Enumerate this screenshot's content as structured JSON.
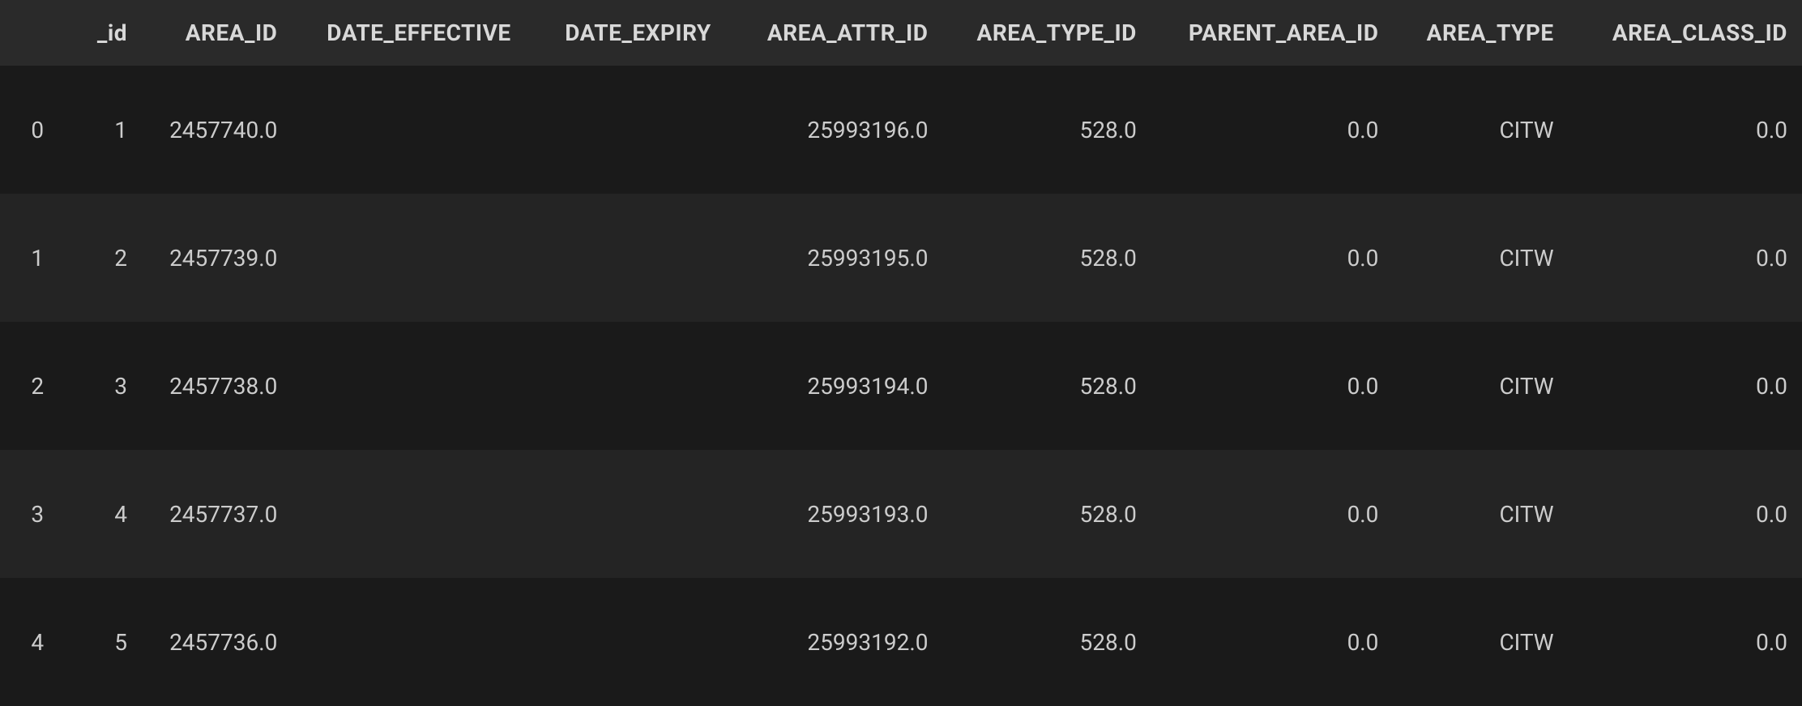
{
  "table": {
    "columns": [
      {
        "key": "_index",
        "label": ""
      },
      {
        "key": "_id",
        "label": "_id"
      },
      {
        "key": "AREA_ID",
        "label": "AREA_ID"
      },
      {
        "key": "DATE_EFFECTIVE",
        "label": "DATE_EFFECTIVE"
      },
      {
        "key": "DATE_EXPIRY",
        "label": "DATE_EXPIRY"
      },
      {
        "key": "AREA_ATTR_ID",
        "label": "AREA_ATTR_ID"
      },
      {
        "key": "AREA_TYPE_ID",
        "label": "AREA_TYPE_ID"
      },
      {
        "key": "PARENT_AREA_ID",
        "label": "PARENT_AREA_ID"
      },
      {
        "key": "AREA_TYPE",
        "label": "AREA_TYPE"
      },
      {
        "key": "AREA_CLASS_ID",
        "label": "AREA_CLASS_ID"
      }
    ],
    "rows": [
      {
        "_index": "0",
        "_id": "1",
        "AREA_ID": "2457740.0",
        "DATE_EFFECTIVE": "",
        "DATE_EXPIRY": "",
        "AREA_ATTR_ID": "25993196.0",
        "AREA_TYPE_ID": "528.0",
        "PARENT_AREA_ID": "0.0",
        "AREA_TYPE": "CITW",
        "AREA_CLASS_ID": "0.0"
      },
      {
        "_index": "1",
        "_id": "2",
        "AREA_ID": "2457739.0",
        "DATE_EFFECTIVE": "",
        "DATE_EXPIRY": "",
        "AREA_ATTR_ID": "25993195.0",
        "AREA_TYPE_ID": "528.0",
        "PARENT_AREA_ID": "0.0",
        "AREA_TYPE": "CITW",
        "AREA_CLASS_ID": "0.0"
      },
      {
        "_index": "2",
        "_id": "3",
        "AREA_ID": "2457738.0",
        "DATE_EFFECTIVE": "",
        "DATE_EXPIRY": "",
        "AREA_ATTR_ID": "25993194.0",
        "AREA_TYPE_ID": "528.0",
        "PARENT_AREA_ID": "0.0",
        "AREA_TYPE": "CITW",
        "AREA_CLASS_ID": "0.0"
      },
      {
        "_index": "3",
        "_id": "4",
        "AREA_ID": "2457737.0",
        "DATE_EFFECTIVE": "",
        "DATE_EXPIRY": "",
        "AREA_ATTR_ID": "25993193.0",
        "AREA_TYPE_ID": "528.0",
        "PARENT_AREA_ID": "0.0",
        "AREA_TYPE": "CITW",
        "AREA_CLASS_ID": "0.0"
      },
      {
        "_index": "4",
        "_id": "5",
        "AREA_ID": "2457736.0",
        "DATE_EFFECTIVE": "",
        "DATE_EXPIRY": "",
        "AREA_ATTR_ID": "25993192.0",
        "AREA_TYPE_ID": "528.0",
        "PARENT_AREA_ID": "0.0",
        "AREA_TYPE": "CITW",
        "AREA_CLASS_ID": "0.0"
      }
    ]
  }
}
